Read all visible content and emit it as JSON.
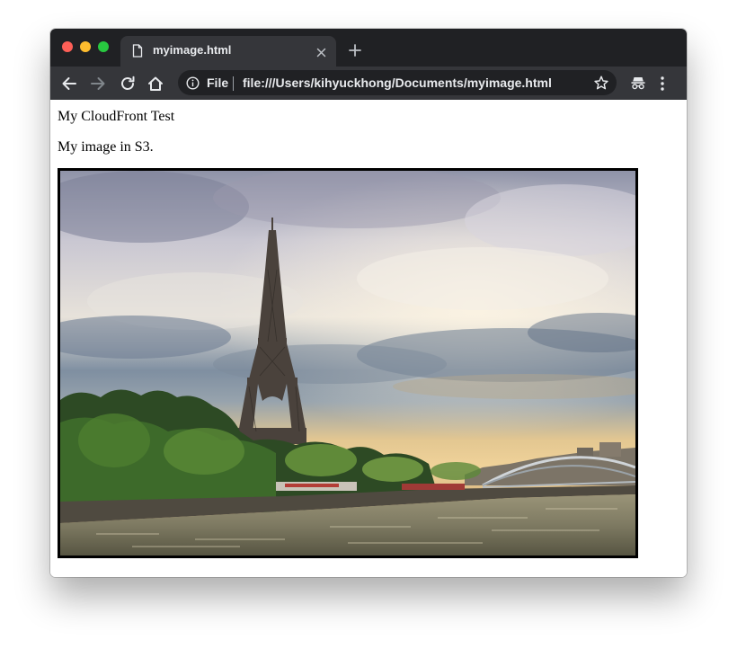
{
  "browser": {
    "tab": {
      "title": "myimage.html"
    },
    "address_bar": {
      "scheme_label": "File",
      "url": "file:///Users/kihyuckhong/Documents/myimage.html"
    },
    "icons": {
      "back": "back-arrow-icon",
      "forward": "forward-arrow-icon",
      "reload": "reload-icon",
      "home": "home-icon",
      "info": "info-icon",
      "bookmark": "star-icon",
      "incognito": "incognito-icon",
      "menu": "kebab-menu-icon"
    }
  },
  "page": {
    "heading_text": "My CloudFront Test",
    "paragraph_text": "My image in S3."
  },
  "colors": {
    "tabstrip": "#202124",
    "toolbar": "#35363a",
    "traffic_red": "#fe5f57",
    "traffic_yellow": "#febc2e",
    "traffic_green": "#28c840"
  }
}
